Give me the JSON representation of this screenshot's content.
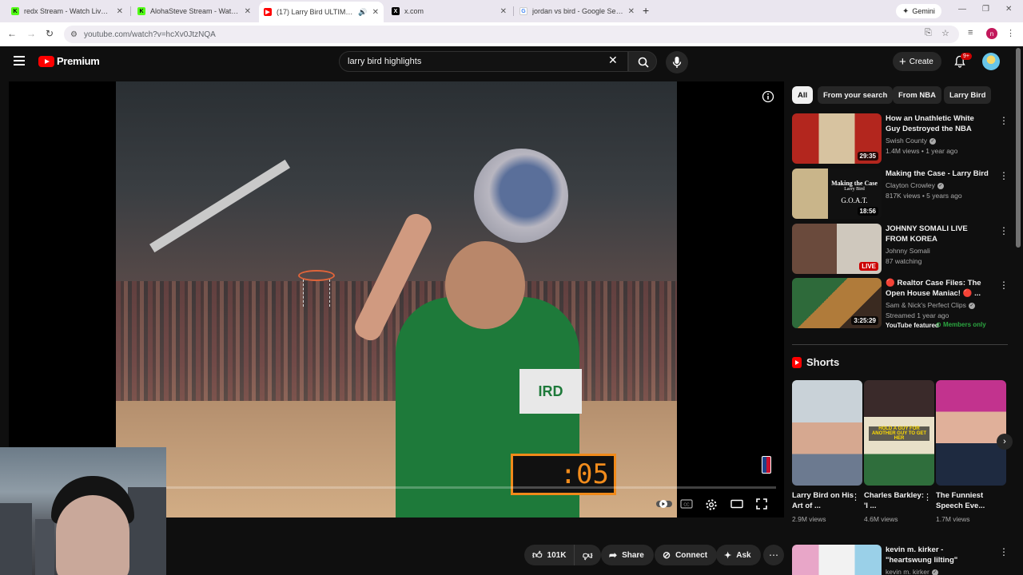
{
  "browser": {
    "tabs": [
      {
        "title": "redx Stream - Watch Live on K",
        "favicon": "kick-icon",
        "color": "#53fc18"
      },
      {
        "title": "AlohaSteve Stream - Watch Liv",
        "favicon": "kick-icon",
        "color": "#53fc18"
      },
      {
        "title": "(17) Larry Bird ULTIMATE M",
        "favicon": "youtube-icon",
        "color": "#ff0000",
        "active": true
      },
      {
        "title": "x.com",
        "favicon": "x-icon",
        "color": "#000000"
      },
      {
        "title": "jordan vs bird - Google Search",
        "favicon": "google-icon",
        "color": "#4285f4"
      }
    ],
    "gemini_label": "Gemini",
    "url": "youtube.com/watch?v=hcXv0JtzNQA",
    "profile_initial": "n"
  },
  "header": {
    "logo_text": "Premium",
    "search_value": "larry bird highlights",
    "create_label": "Create",
    "notification_badge": "9+"
  },
  "player": {
    "scoreboard_text": ":05",
    "jersey_text": "IRD",
    "progress_fraction": 0.0
  },
  "actions": {
    "like_count": "101K",
    "share_label": "Share",
    "connect_label": "Connect",
    "ask_label": "Ask"
  },
  "chips": [
    "All",
    "From your search",
    "From NBA",
    "Larry Bird"
  ],
  "recommendations": [
    {
      "title": "How an Unathletic White Guy Destroyed the NBA",
      "channel": "Swish County",
      "verified": true,
      "meta": "1.4M views • 1 year ago",
      "duration": "29:35"
    },
    {
      "title": "Making the Case - Larry Bird",
      "channel": "Clayton Crowley",
      "verified": true,
      "meta": "817K views • 5 years ago",
      "duration": "18:56",
      "thumb_text": "Making the Case",
      "thumb_sub": "Larry Bird",
      "thumb_goat": "G.O.A.T."
    },
    {
      "title": "JOHNNY SOMALI LIVE FROM KOREA",
      "channel": "Johnny Somali",
      "verified": false,
      "meta": "87 watching",
      "live": "LIVE"
    },
    {
      "title": "🔴 Realtor Case Files: The Open House Maniac! 🔴 ...",
      "channel": "Sam & Nick's Perfect Clips",
      "verified": true,
      "meta": "Streamed 1 year ago",
      "duration": "3:25:29",
      "featured": "YouTube featured",
      "members": "Members only"
    }
  ],
  "shorts": {
    "heading": "Shorts",
    "items": [
      {
        "title": "Larry Bird on His Art of ...",
        "views": "2.9M views"
      },
      {
        "title": "Charles Barkley: 'I ...",
        "views": "4.6M views",
        "overlay": "HOLD A GUY FOR ANOTHER GUY TO GET HER"
      },
      {
        "title": "The Funniest Speech Eve...",
        "views": "1.7M views"
      }
    ]
  },
  "next_rec": {
    "title": "kevin m. kirker - \"heartswung lilting\"",
    "channel": "kevin m. kirker"
  },
  "colors": {
    "accent": "#ff0000",
    "background": "#0f0f0f",
    "chip_bg": "#272727",
    "members_green": "#2ba640"
  }
}
